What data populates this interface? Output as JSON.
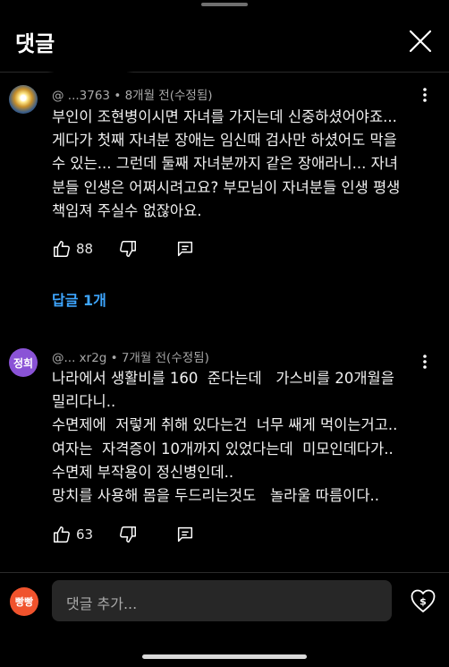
{
  "header": {
    "title": "댓글"
  },
  "comments": [
    {
      "avatar_icon": "avatar-image",
      "author": "@ ...3763",
      "meta": " • 8개월 전(수정됨)",
      "text": "부인이 조현병이시면 자녀를 가지는데 신중하셨어야죠...\n게다가 첫째 자녀분 장애는 임신때 검사만 하셨어도 막을\n수 있는... 그런데 둘째 자녀분까지 같은 장애라니... 자녀\n분들 인생은 어쩌시려고요? 부모님이 자녀분들 인생 평생\n책임져 주실수 없잖아요.",
      "likes": "88",
      "replies_label": "답글 1개"
    },
    {
      "avatar_text": "정희",
      "author": "@... xr2g",
      "meta": " • 7개월 전(수정됨)",
      "text": "나라에서 생활비를 160  준다는데   가스비를 20개월을\n밀리다니..\n수면제에  저렇게 취해 있다는건  너무 쌔게 먹이는거고..\n여자는  자격증이 10개까지 있었다는데  미모인데다가..\n수면제 부작용이 정신병인데..\n망치를 사용해 몸을 두드리는것도   놀라울 따름이다..",
      "likes": "63"
    }
  ],
  "composer": {
    "user_avatar_text": "빵빵",
    "placeholder": "댓글 추가..."
  },
  "colors": {
    "background": "#000000",
    "link": "#3ea6ff",
    "input_bg": "#272727"
  }
}
